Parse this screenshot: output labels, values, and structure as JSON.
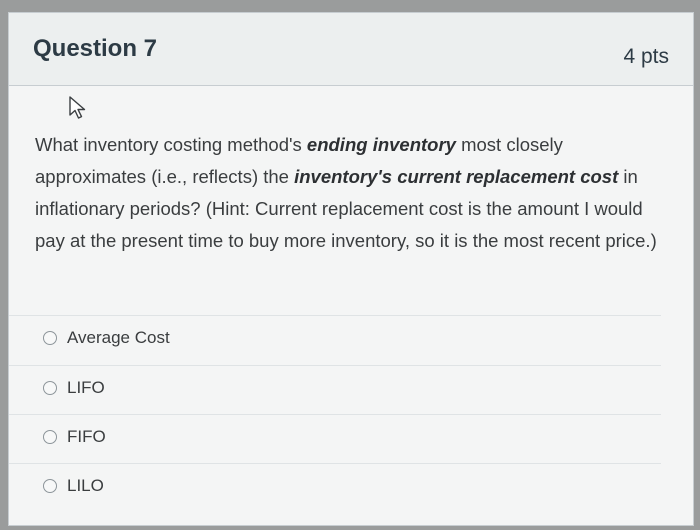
{
  "question": {
    "title": "Question 7",
    "points": "4 pts",
    "text_parts": [
      "What inventory costing method's ",
      "ending inventory",
      " most closely approximates (i.e., reflects) the ",
      "inventory's current replacement cost",
      " in inflationary periods? (Hint: Current replacement cost is the amount I would pay at the present time to buy more inventory, so it is the most recent price.)"
    ]
  },
  "answers": [
    {
      "label": "Average Cost"
    },
    {
      "label": "LIFO"
    },
    {
      "label": "FIFO"
    },
    {
      "label": "LILO"
    }
  ],
  "icons": {
    "cursor": "mouse-pointer-icon",
    "radio": "radio-unselected-icon"
  }
}
